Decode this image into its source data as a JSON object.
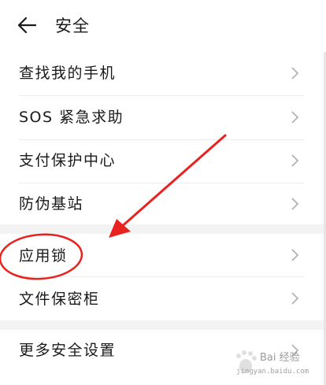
{
  "header": {
    "title": "安全",
    "back_icon": "arrow-left-icon"
  },
  "groups": [
    {
      "items": [
        {
          "label": "查找我的手机"
        },
        {
          "label": "SOS 紧急求助"
        },
        {
          "label": "支付保护中心"
        },
        {
          "label": "防伪基站"
        }
      ]
    },
    {
      "items": [
        {
          "label": "应用锁"
        },
        {
          "label": "文件保密柜"
        }
      ]
    },
    {
      "items": [
        {
          "label": "更多安全设置"
        }
      ]
    }
  ],
  "annotations": {
    "arrow_color": "#e8231f",
    "circle_color": "#e8231f",
    "highlight": "应用锁"
  },
  "watermark": {
    "text": "Bai 经验",
    "url": "jingyan.baidu.com"
  },
  "colors": {
    "chevron": "#b3b3b3",
    "group_gap": "#f3f3f3"
  }
}
